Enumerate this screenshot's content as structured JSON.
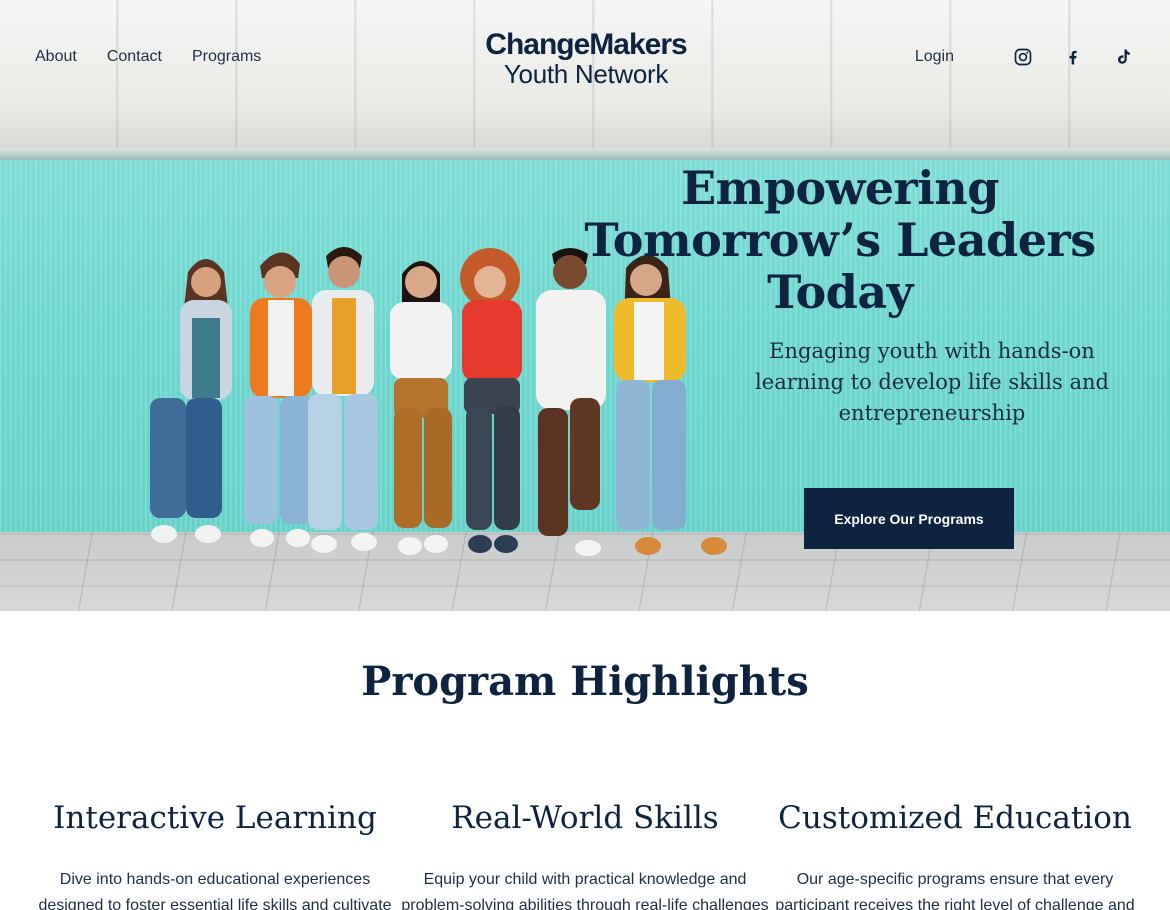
{
  "nav": {
    "links": [
      {
        "label": "About"
      },
      {
        "label": "Contact"
      },
      {
        "label": "Programs"
      }
    ],
    "login": "Login",
    "social": [
      "instagram-icon",
      "facebook-icon",
      "tiktok-icon"
    ]
  },
  "logo": {
    "line1": "ChangeMakers",
    "line2": "Youth Network"
  },
  "hero": {
    "title": "Empowering Tomorrow’s Leaders Today",
    "subtitle": "Engaging youth with hands-on learning to develop life skills and entrepreneurship",
    "cta": "Explore Our Programs"
  },
  "highlights": {
    "title": "Program Highlights",
    "items": [
      {
        "heading": "Interactive Learning",
        "text": "Dive into hands-on educational experiences designed to foster essential life skills and cultivate independent"
      },
      {
        "heading": "Real-World Skills",
        "text": "Equip your child with practical knowledge and problem-solving abilities through real-life challenges"
      },
      {
        "heading": "Customized Education",
        "text": "Our age-specific programs ensure that every participant receives the right level of challenge and"
      }
    ]
  },
  "colors": {
    "navy": "#0d2340",
    "teal_wall": "#6fd8d0"
  }
}
